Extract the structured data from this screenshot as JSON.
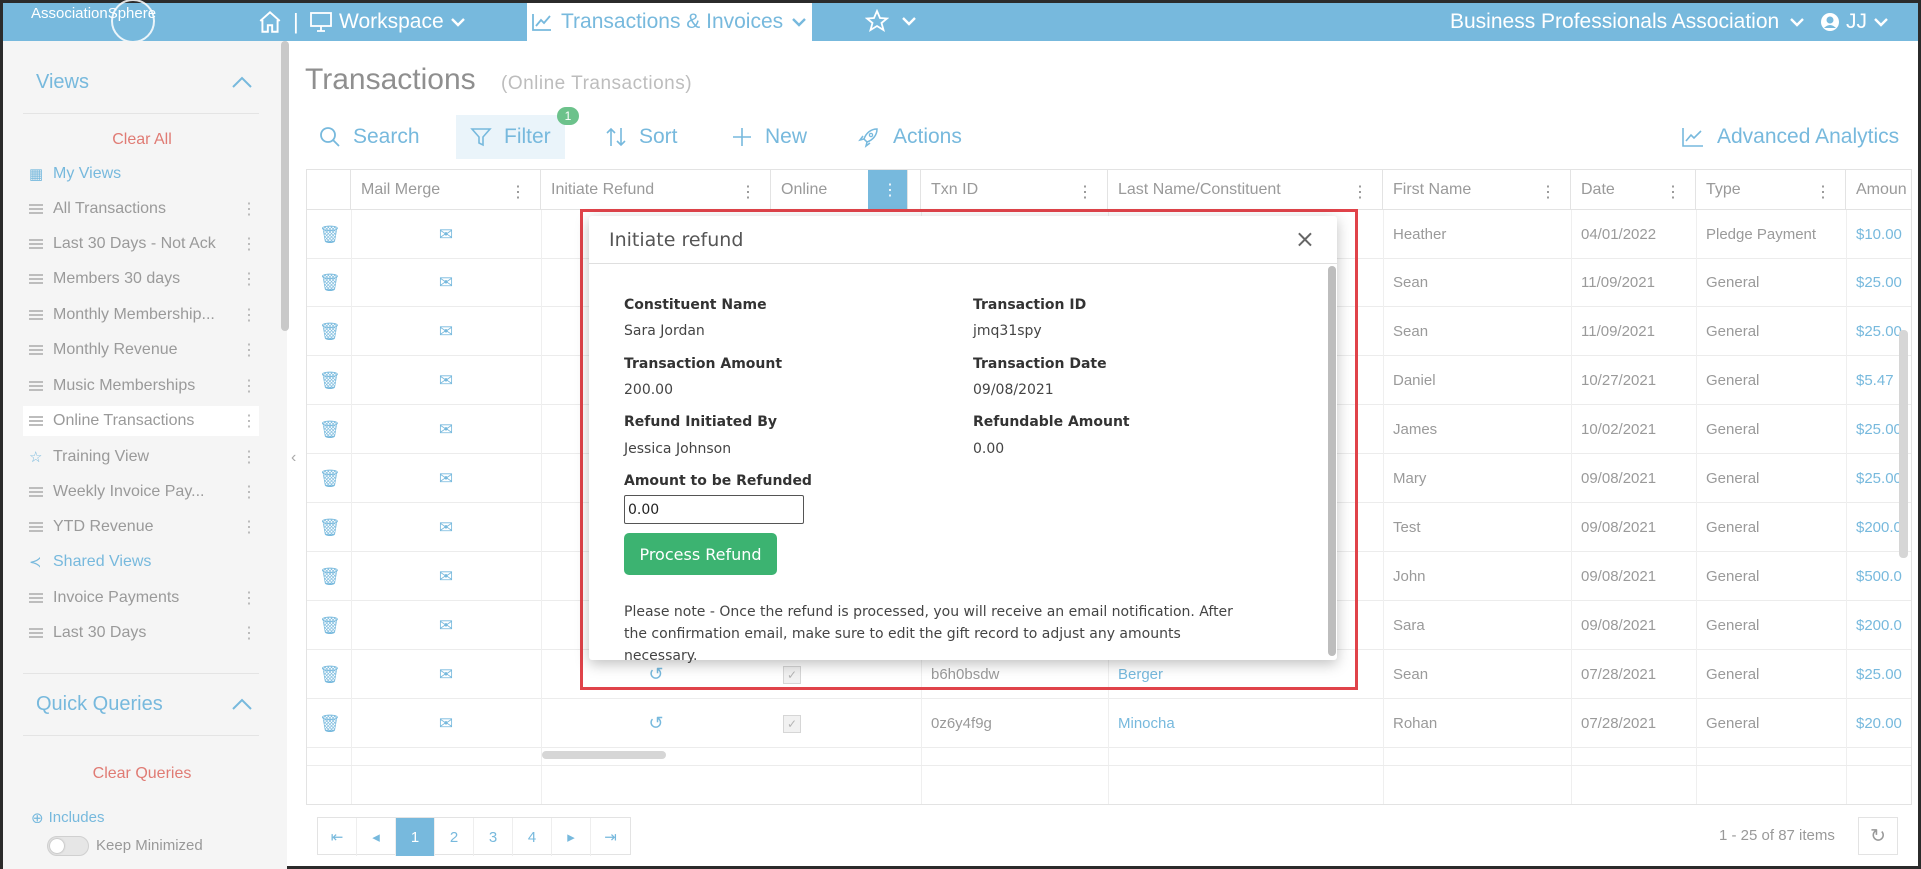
{
  "topnav": {
    "logo": "AssociationSphere",
    "workspace": "Workspace",
    "active_tab": "Transactions & Invoices",
    "organization": "Business Professionals Association",
    "user_initials": "JJ"
  },
  "sidebar": {
    "views_heading": "Views",
    "clear_all": "Clear All",
    "items": [
      {
        "label": "My Views",
        "kind": "link"
      },
      {
        "label": "All Transactions"
      },
      {
        "label": "Last 30 Days - Not Ack"
      },
      {
        "label": "Members 30 days"
      },
      {
        "label": "Monthly Membership..."
      },
      {
        "label": "Monthly Revenue"
      },
      {
        "label": "Music Memberships"
      },
      {
        "label": "Online Transactions",
        "active": true
      },
      {
        "label": "Training View",
        "kind": "star"
      },
      {
        "label": "Weekly Invoice Pay..."
      },
      {
        "label": "YTD Revenue"
      },
      {
        "label": "Shared Views",
        "kind": "link"
      },
      {
        "label": "Invoice Payments"
      },
      {
        "label": "Last 30 Days"
      }
    ],
    "quick_queries_heading": "Quick Queries",
    "clear_queries": "Clear Queries",
    "includes": "Includes",
    "keep_minimized": "Keep Minimized"
  },
  "page": {
    "title": "Transactions",
    "subtitle": "(Online Transactions)"
  },
  "toolbar": {
    "search": "Search",
    "filter": "Filter",
    "filter_count": "1",
    "sort": "Sort",
    "new": "New",
    "actions": "Actions",
    "analytics": "Advanced Analytics"
  },
  "grid": {
    "columns": [
      "Mail Merge",
      "Initiate Refund",
      "Online",
      "Txn ID",
      "Last Name/Constituent",
      "First Name",
      "Date",
      "Type",
      "Amount"
    ],
    "columns_visible": [
      "Mail Merge",
      "Initiate Refund",
      "Online",
      "Txn ID",
      "Last Name/Constituent",
      "First Name",
      "Date",
      "Type",
      "Amoun"
    ],
    "rows": [
      {
        "first": "Heather",
        "date": "04/01/2022",
        "type": "Pledge Payment",
        "amount": "$10.00"
      },
      {
        "first": "Sean",
        "date": "11/09/2021",
        "type": "General",
        "amount": "$25.00"
      },
      {
        "first": "Sean",
        "date": "11/09/2021",
        "type": "General",
        "amount": "$25.00"
      },
      {
        "first": "Daniel",
        "date": "10/27/2021",
        "type": "General",
        "amount": "$5.47"
      },
      {
        "first": "James",
        "date": "10/02/2021",
        "type": "General",
        "amount": "$25.00"
      },
      {
        "first": "Mary",
        "date": "09/08/2021",
        "type": "General",
        "amount": "$25.00"
      },
      {
        "first": "Test",
        "date": "09/08/2021",
        "type": "General",
        "amount": "$200.0"
      },
      {
        "first": "John",
        "date": "09/08/2021",
        "type": "General",
        "amount": "$500.0"
      },
      {
        "first": "Sara",
        "date": "09/08/2021",
        "type": "General",
        "amount": "$200.0"
      },
      {
        "txn": "b6h0bsdw",
        "last": "Berger",
        "first": "Sean",
        "date": "07/28/2021",
        "type": "General",
        "amount": "$25.00"
      },
      {
        "txn": "0z6y4f9g",
        "last": "Minocha",
        "first": "Rohan",
        "date": "07/28/2021",
        "type": "General",
        "amount": "$20.00"
      }
    ]
  },
  "pager": {
    "pages": [
      "1",
      "2",
      "3",
      "4"
    ],
    "current": "1",
    "info": "1 - 25 of 87 items"
  },
  "modal": {
    "title": "Initiate refund",
    "constituent_name_label": "Constituent Name",
    "constituent_name": "Sara Jordan",
    "transaction_id_label": "Transaction ID",
    "transaction_id": "jmq31spy",
    "transaction_amount_label": "Transaction Amount",
    "transaction_amount": "200.00",
    "transaction_date_label": "Transaction Date",
    "transaction_date": "09/08/2021",
    "initiated_by_label": "Refund Initiated By",
    "initiated_by": "Jessica Johnson",
    "refundable_amount_label": "Refundable Amount",
    "refundable_amount": "0.00",
    "amount_to_refund_label": "Amount to be Refunded",
    "amount_to_refund_value": "0.00",
    "process_button": "Process Refund",
    "note": "Please note - Once the refund is processed, you will receive an email notification. After the confirmation email, make sure to edit the gift record to adjust any amounts necessary."
  },
  "colors": {
    "brand": "#77b9dd",
    "clear_link": "#e07b74",
    "process_button": "#3cb371",
    "highlight_outline": "#e0434a"
  }
}
